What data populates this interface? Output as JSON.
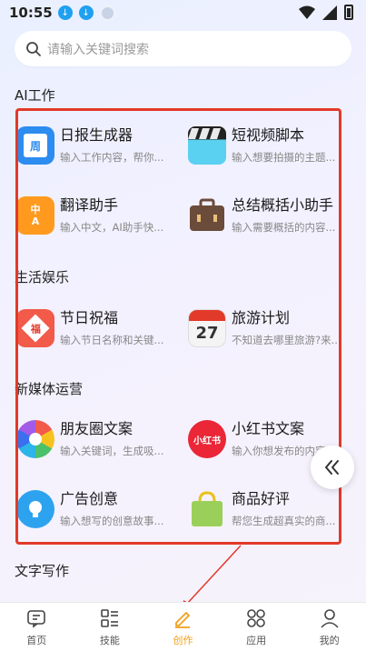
{
  "status": {
    "time": "10:55"
  },
  "search": {
    "placeholder": "请输入关键词搜索"
  },
  "sections": {
    "ai_work": "AI工作",
    "life": "生活娱乐",
    "media": "新媒体运营",
    "writing": "文字写作"
  },
  "cards": {
    "daily_report": {
      "title": "日报生成器",
      "desc": "输入工作内容，帮你..."
    },
    "short_video": {
      "title": "短视频脚本",
      "desc": "输入想要拍摄的主题..."
    },
    "translate": {
      "title": "翻译助手",
      "desc": "输入中文，AI助手快..."
    },
    "summary": {
      "title": "总结概括小助手",
      "desc": "输入需要概括的内容..."
    },
    "holiday": {
      "title": "节日祝福",
      "desc": "输入节日名称和关键..."
    },
    "travel": {
      "title": "旅游计划",
      "desc": "不知道去哪里旅游?来..."
    },
    "moments": {
      "title": "朋友圈文案",
      "desc": "输入关键词，生成吸..."
    },
    "xiaohongshu": {
      "title": "小红书文案",
      "desc": "输入你想发布的内容..."
    },
    "ad": {
      "title": "广告创意",
      "desc": "输入想写的创意故事..."
    },
    "review": {
      "title": "商品好评",
      "desc": "帮您生成超真实的商..."
    }
  },
  "icon_text": {
    "calendar_small": "周",
    "translate_zh": "中",
    "translate_a": "A",
    "fu": "福",
    "date": "27",
    "xhs": "小红书"
  },
  "nav": [
    {
      "label": "首页",
      "icon": "home-icon"
    },
    {
      "label": "技能",
      "icon": "skills-icon"
    },
    {
      "label": "创作",
      "icon": "pencil-icon"
    },
    {
      "label": "应用",
      "icon": "apps-icon"
    },
    {
      "label": "我的",
      "icon": "user-icon"
    }
  ],
  "colors": {
    "accent": "#f0a020",
    "highlight": "#e2392a"
  }
}
